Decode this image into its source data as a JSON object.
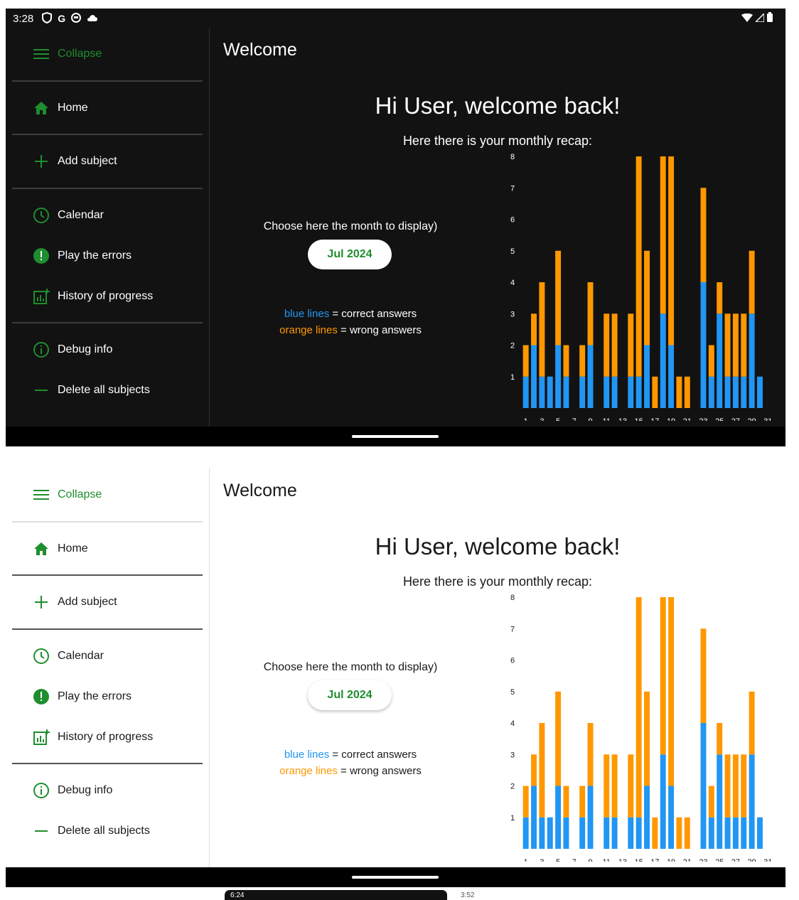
{
  "status_bar": {
    "time": "3:28",
    "icons": [
      "vpn-shield-icon",
      "google-g-icon",
      "app-icon",
      "cloud-icon"
    ],
    "right_icons": [
      "wifi-icon",
      "signal-icon",
      "battery-icon"
    ]
  },
  "sidebar": {
    "collapse_label": "Collapse",
    "items": [
      {
        "label": "Home",
        "icon": "home-icon"
      },
      {
        "label": "Add subject",
        "icon": "plus-icon"
      },
      {
        "label": "Calendar",
        "icon": "clock-icon"
      },
      {
        "label": "Play the errors",
        "icon": "alert-circle-icon"
      },
      {
        "label": "History of progress",
        "icon": "chart-add-icon"
      },
      {
        "label": "Debug info",
        "icon": "info-icon"
      },
      {
        "label": "Delete all subjects",
        "icon": "minus-icon"
      }
    ]
  },
  "main": {
    "title": "Welcome",
    "greeting": "Hi User, welcome back!",
    "recap": "Here there is your monthly recap:",
    "choose_label": "Choose here the month to display)",
    "month_button": "Jul 2024",
    "legend": {
      "blue_word": "blue lines",
      "blue_rest": " = correct answers",
      "orange_word": "orange lines",
      "orange_rest": " = wrong answers"
    }
  },
  "colors": {
    "accent": "#1e8e2e",
    "correct": "#2196f3",
    "wrong": "#ff9800",
    "dark_bg": "#121212"
  },
  "thumbnails": {
    "left_time": "6:24",
    "right_time": "3:52"
  },
  "chart_data": {
    "type": "bar",
    "stacked": true,
    "x": [
      1,
      2,
      3,
      4,
      5,
      6,
      7,
      8,
      9,
      10,
      11,
      12,
      13,
      14,
      15,
      16,
      17,
      18,
      19,
      20,
      21,
      22,
      23,
      24,
      25,
      26,
      27,
      28,
      29,
      30,
      31
    ],
    "x_tick_labels": [
      "1",
      "3",
      "5",
      "7",
      "9",
      "11",
      "13",
      "15",
      "17",
      "19",
      "21",
      "23",
      "25",
      "27",
      "29",
      "31"
    ],
    "ylim": [
      0,
      8
    ],
    "y_ticks": [
      1,
      2,
      3,
      4,
      5,
      6,
      7,
      8
    ],
    "series": [
      {
        "color": "#2196f3",
        "values": [
          1,
          2,
          1,
          1,
          2,
          1,
          0,
          1,
          2,
          0,
          1,
          1,
          0,
          1,
          1,
          2,
          0,
          3,
          2,
          0,
          0,
          0,
          4,
          1,
          3,
          1,
          1,
          1,
          3,
          1,
          0
        ]
      },
      {
        "color": "#ff9800",
        "values": [
          1,
          1,
          3,
          0,
          3,
          1,
          0,
          1,
          2,
          0,
          2,
          2,
          0,
          2,
          7,
          3,
          1,
          5,
          6,
          1,
          1,
          0,
          3,
          1,
          1,
          2,
          2,
          2,
          2,
          0,
          0
        ]
      }
    ]
  }
}
